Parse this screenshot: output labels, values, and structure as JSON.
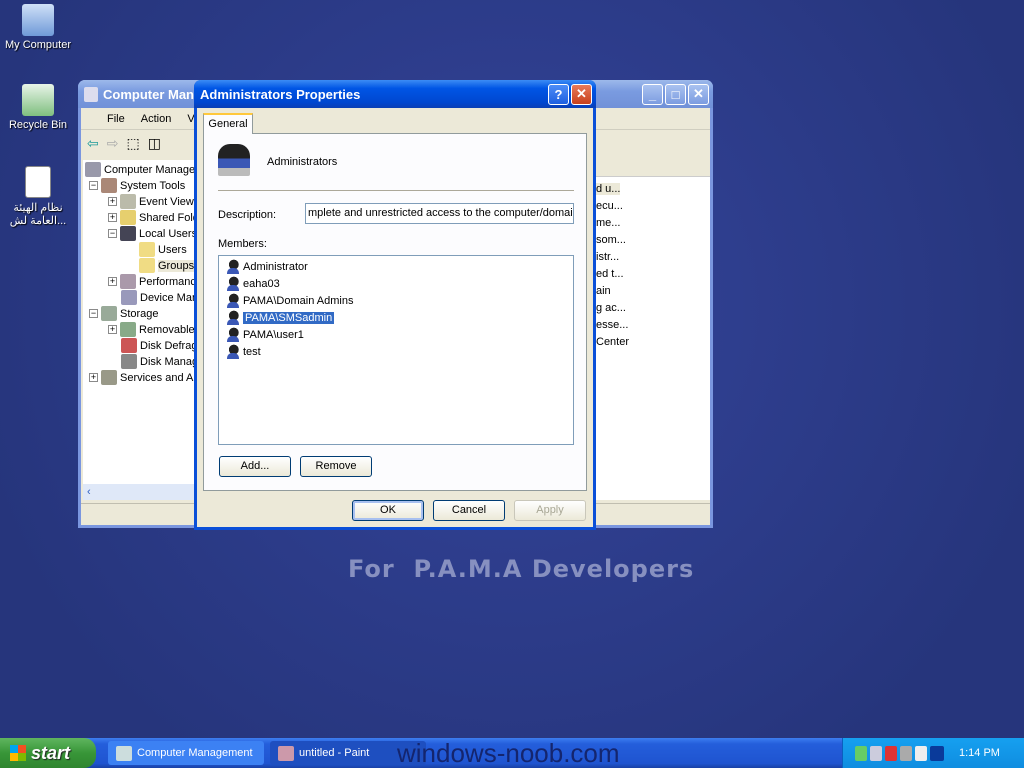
{
  "desktop": {
    "icons": [
      {
        "label": "My Computer"
      },
      {
        "label": "Recycle Bin"
      },
      {
        "label": "نظام الهيئة العامة لش..."
      }
    ],
    "wallpaper_text": "For  P.A.M.A Developers"
  },
  "cm_window": {
    "title": "Computer Management",
    "menu": [
      "File",
      "Action",
      "View"
    ],
    "tree": [
      "Computer Management",
      "System Tools",
      "Event Viewer",
      "Shared Folders",
      "Local Users",
      "Users",
      "Groups",
      "Performance",
      "Device Manager",
      "Storage",
      "Removable",
      "Disk Defrag",
      "Disk Management",
      "Services and A"
    ],
    "right_items": [
      "d u...",
      "ecu...",
      "me...",
      "som...",
      "istr...",
      "ed t...",
      "ain",
      "g ac...",
      "esse...",
      "Center"
    ]
  },
  "dialog": {
    "title": "Administrators Properties",
    "tab": "General",
    "group_name": "Administrators",
    "description_label": "Description:",
    "description_value": "mplete and unrestricted access to the computer/domain",
    "members_label": "Members:",
    "members": [
      "Administrator",
      "eaha03",
      "PAMA\\Domain Admins",
      "PAMA\\SMSadmin",
      "PAMA\\user1",
      "test"
    ],
    "selected_member": "PAMA\\SMSadmin",
    "add_label": "Add...",
    "remove_label": "Remove",
    "ok_label": "OK",
    "cancel_label": "Cancel",
    "apply_label": "Apply"
  },
  "taskbar": {
    "start_label": "start",
    "tasks": [
      "Computer Management",
      "untitled - Paint"
    ],
    "clock": "1:14 PM",
    "overlay_text": "windows-noob.com"
  }
}
